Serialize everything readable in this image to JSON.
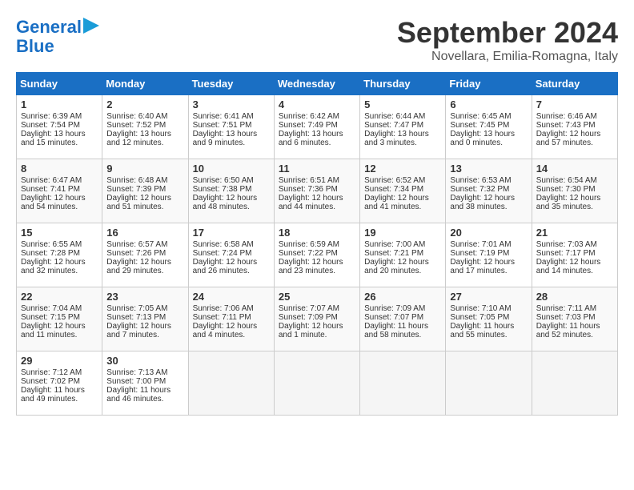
{
  "logo": {
    "text1": "General",
    "text2": "Blue"
  },
  "title": "September 2024",
  "location": "Novellara, Emilia-Romagna, Italy",
  "headers": [
    "Sunday",
    "Monday",
    "Tuesday",
    "Wednesday",
    "Thursday",
    "Friday",
    "Saturday"
  ],
  "weeks": [
    [
      {
        "day": "1",
        "lines": [
          "Sunrise: 6:39 AM",
          "Sunset: 7:54 PM",
          "Daylight: 13 hours",
          "and 15 minutes."
        ]
      },
      {
        "day": "2",
        "lines": [
          "Sunrise: 6:40 AM",
          "Sunset: 7:52 PM",
          "Daylight: 13 hours",
          "and 12 minutes."
        ]
      },
      {
        "day": "3",
        "lines": [
          "Sunrise: 6:41 AM",
          "Sunset: 7:51 PM",
          "Daylight: 13 hours",
          "and 9 minutes."
        ]
      },
      {
        "day": "4",
        "lines": [
          "Sunrise: 6:42 AM",
          "Sunset: 7:49 PM",
          "Daylight: 13 hours",
          "and 6 minutes."
        ]
      },
      {
        "day": "5",
        "lines": [
          "Sunrise: 6:44 AM",
          "Sunset: 7:47 PM",
          "Daylight: 13 hours",
          "and 3 minutes."
        ]
      },
      {
        "day": "6",
        "lines": [
          "Sunrise: 6:45 AM",
          "Sunset: 7:45 PM",
          "Daylight: 13 hours",
          "and 0 minutes."
        ]
      },
      {
        "day": "7",
        "lines": [
          "Sunrise: 6:46 AM",
          "Sunset: 7:43 PM",
          "Daylight: 12 hours",
          "and 57 minutes."
        ]
      }
    ],
    [
      {
        "day": "8",
        "lines": [
          "Sunrise: 6:47 AM",
          "Sunset: 7:41 PM",
          "Daylight: 12 hours",
          "and 54 minutes."
        ]
      },
      {
        "day": "9",
        "lines": [
          "Sunrise: 6:48 AM",
          "Sunset: 7:39 PM",
          "Daylight: 12 hours",
          "and 51 minutes."
        ]
      },
      {
        "day": "10",
        "lines": [
          "Sunrise: 6:50 AM",
          "Sunset: 7:38 PM",
          "Daylight: 12 hours",
          "and 48 minutes."
        ]
      },
      {
        "day": "11",
        "lines": [
          "Sunrise: 6:51 AM",
          "Sunset: 7:36 PM",
          "Daylight: 12 hours",
          "and 44 minutes."
        ]
      },
      {
        "day": "12",
        "lines": [
          "Sunrise: 6:52 AM",
          "Sunset: 7:34 PM",
          "Daylight: 12 hours",
          "and 41 minutes."
        ]
      },
      {
        "day": "13",
        "lines": [
          "Sunrise: 6:53 AM",
          "Sunset: 7:32 PM",
          "Daylight: 12 hours",
          "and 38 minutes."
        ]
      },
      {
        "day": "14",
        "lines": [
          "Sunrise: 6:54 AM",
          "Sunset: 7:30 PM",
          "Daylight: 12 hours",
          "and 35 minutes."
        ]
      }
    ],
    [
      {
        "day": "15",
        "lines": [
          "Sunrise: 6:55 AM",
          "Sunset: 7:28 PM",
          "Daylight: 12 hours",
          "and 32 minutes."
        ]
      },
      {
        "day": "16",
        "lines": [
          "Sunrise: 6:57 AM",
          "Sunset: 7:26 PM",
          "Daylight: 12 hours",
          "and 29 minutes."
        ]
      },
      {
        "day": "17",
        "lines": [
          "Sunrise: 6:58 AM",
          "Sunset: 7:24 PM",
          "Daylight: 12 hours",
          "and 26 minutes."
        ]
      },
      {
        "day": "18",
        "lines": [
          "Sunrise: 6:59 AM",
          "Sunset: 7:22 PM",
          "Daylight: 12 hours",
          "and 23 minutes."
        ]
      },
      {
        "day": "19",
        "lines": [
          "Sunrise: 7:00 AM",
          "Sunset: 7:21 PM",
          "Daylight: 12 hours",
          "and 20 minutes."
        ]
      },
      {
        "day": "20",
        "lines": [
          "Sunrise: 7:01 AM",
          "Sunset: 7:19 PM",
          "Daylight: 12 hours",
          "and 17 minutes."
        ]
      },
      {
        "day": "21",
        "lines": [
          "Sunrise: 7:03 AM",
          "Sunset: 7:17 PM",
          "Daylight: 12 hours",
          "and 14 minutes."
        ]
      }
    ],
    [
      {
        "day": "22",
        "lines": [
          "Sunrise: 7:04 AM",
          "Sunset: 7:15 PM",
          "Daylight: 12 hours",
          "and 11 minutes."
        ]
      },
      {
        "day": "23",
        "lines": [
          "Sunrise: 7:05 AM",
          "Sunset: 7:13 PM",
          "Daylight: 12 hours",
          "and 7 minutes."
        ]
      },
      {
        "day": "24",
        "lines": [
          "Sunrise: 7:06 AM",
          "Sunset: 7:11 PM",
          "Daylight: 12 hours",
          "and 4 minutes."
        ]
      },
      {
        "day": "25",
        "lines": [
          "Sunrise: 7:07 AM",
          "Sunset: 7:09 PM",
          "Daylight: 12 hours",
          "and 1 minute."
        ]
      },
      {
        "day": "26",
        "lines": [
          "Sunrise: 7:09 AM",
          "Sunset: 7:07 PM",
          "Daylight: 11 hours",
          "and 58 minutes."
        ]
      },
      {
        "day": "27",
        "lines": [
          "Sunrise: 7:10 AM",
          "Sunset: 7:05 PM",
          "Daylight: 11 hours",
          "and 55 minutes."
        ]
      },
      {
        "day": "28",
        "lines": [
          "Sunrise: 7:11 AM",
          "Sunset: 7:03 PM",
          "Daylight: 11 hours",
          "and 52 minutes."
        ]
      }
    ],
    [
      {
        "day": "29",
        "lines": [
          "Sunrise: 7:12 AM",
          "Sunset: 7:02 PM",
          "Daylight: 11 hours",
          "and 49 minutes."
        ]
      },
      {
        "day": "30",
        "lines": [
          "Sunrise: 7:13 AM",
          "Sunset: 7:00 PM",
          "Daylight: 11 hours",
          "and 46 minutes."
        ]
      },
      {
        "day": "",
        "lines": []
      },
      {
        "day": "",
        "lines": []
      },
      {
        "day": "",
        "lines": []
      },
      {
        "day": "",
        "lines": []
      },
      {
        "day": "",
        "lines": []
      }
    ]
  ]
}
